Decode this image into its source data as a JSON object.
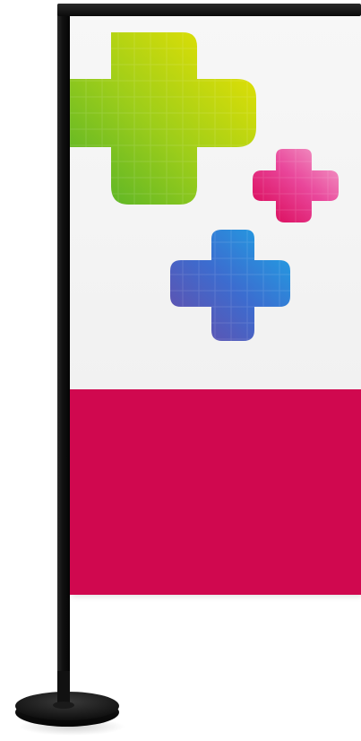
{
  "scene": {
    "subject": "flag-banner-on-stand",
    "colors": {
      "pole": "#111111",
      "flag_top": "#f4f4f4",
      "flag_bottom": "#d0084f",
      "cross_green_yellow": "#b8d80a",
      "cross_pink": "#e0438c",
      "cross_blue": "#3f7fd6",
      "base": "#0e0e0e"
    },
    "icons": [
      "green-yellow-plus-icon",
      "pink-plus-icon",
      "blue-plus-icon"
    ]
  }
}
